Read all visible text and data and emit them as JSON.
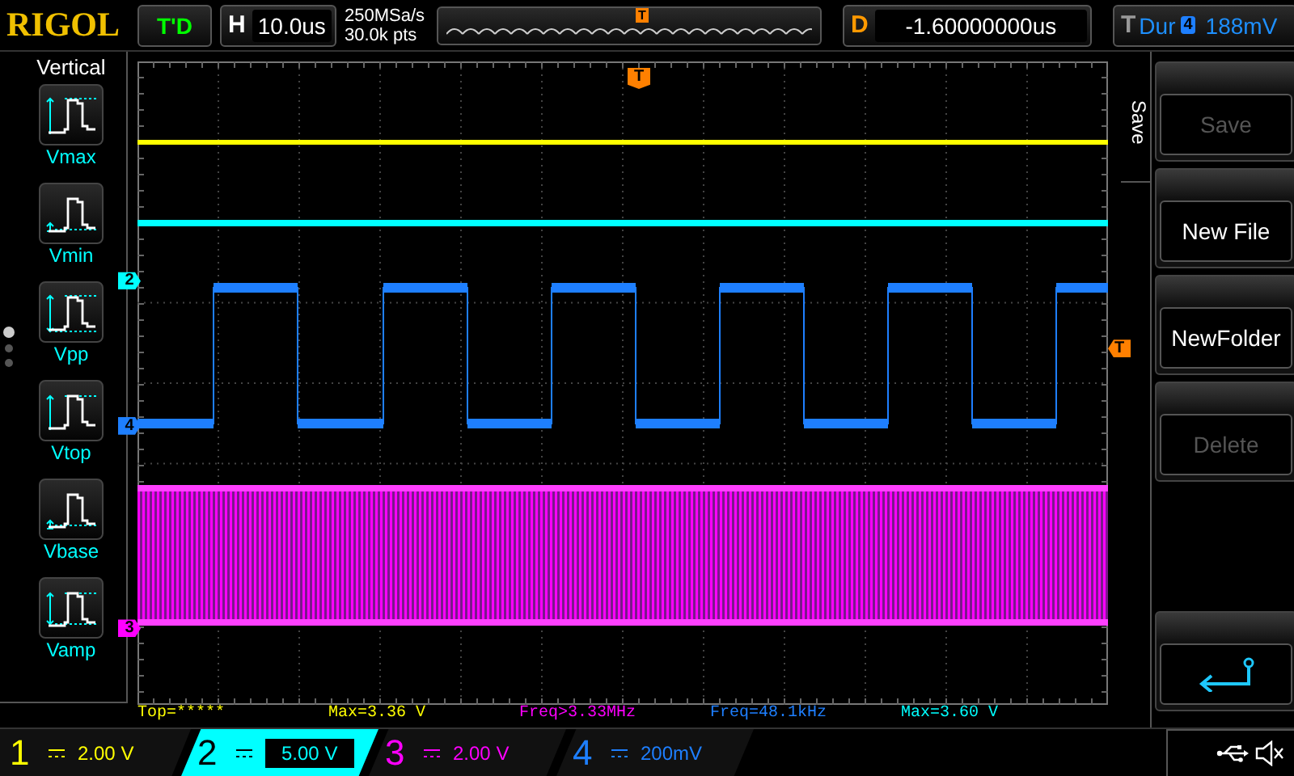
{
  "brand": "RIGOL",
  "run_status": "T'D",
  "horizontal": {
    "label": "H",
    "value": "10.0us"
  },
  "acquisition": {
    "sample_rate": "250MSa/s",
    "memory_depth": "30.0k pts"
  },
  "timeline": {
    "trigger_label": "T"
  },
  "delay": {
    "label": "D",
    "value": "-1.60000000us"
  },
  "trigger": {
    "label": "T",
    "type": "Dur",
    "source": "4",
    "voltage": "188mV"
  },
  "left_menu": {
    "title": "Vertical",
    "pages": [
      {
        "selected": true
      },
      {
        "selected": false
      },
      {
        "selected": false
      }
    ],
    "items": [
      {
        "label": "Vmax",
        "kind": "vmax"
      },
      {
        "label": "Vmin",
        "kind": "vmin"
      },
      {
        "label": "Vpp",
        "kind": "vpp"
      },
      {
        "label": "Vtop",
        "kind": "vtop"
      },
      {
        "label": "Vbase",
        "kind": "vbase"
      },
      {
        "label": "Vamp",
        "kind": "vamp"
      }
    ]
  },
  "channel_markers": [
    {
      "label": "2",
      "color": "#00ffff"
    },
    {
      "label": "4",
      "color": "#1e7fff"
    },
    {
      "label": "3",
      "color": "#ff00ff"
    }
  ],
  "trigger_level_marker": {
    "label": "T"
  },
  "trigger_position_marker": {
    "label": "T"
  },
  "measurements": [
    {
      "text": "Top=*****",
      "color": "#ffff00"
    },
    {
      "text": "Max=3.36 V",
      "color": "#ffff00"
    },
    {
      "text": "Freq>3.33MHz",
      "color": "#ff00ff"
    },
    {
      "text": "Freq=48.1kHz",
      "color": "#1e7fff"
    },
    {
      "text": "Max=3.60 V",
      "color": "#00ffff"
    }
  ],
  "channels": [
    {
      "number": "1",
      "scale": "2.00 V",
      "color": "#ffff00",
      "selected": false
    },
    {
      "number": "2",
      "scale": "5.00 V",
      "color": "#00ffff",
      "selected": true
    },
    {
      "number": "3",
      "scale": "2.00 V",
      "color": "#ff00ff",
      "selected": false
    },
    {
      "number": "4",
      "scale": "200mV",
      "color": "#1e7fff",
      "selected": false
    }
  ],
  "save_menu": {
    "title": "Save",
    "items": [
      {
        "label": "Save",
        "disabled": true
      },
      {
        "label": "New File",
        "disabled": false
      },
      {
        "label": "NewFolder",
        "disabled": false
      },
      {
        "label": "Delete",
        "disabled": true
      }
    ]
  }
}
